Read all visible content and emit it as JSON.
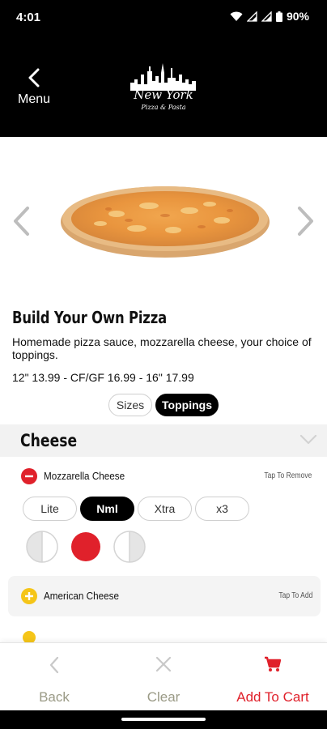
{
  "status_bar": {
    "time": "4:01",
    "battery": "90%"
  },
  "header": {
    "back_label": "Menu",
    "logo_title": "New York",
    "logo_subtitle": "Pizza & Pasta"
  },
  "product": {
    "title": "Build Your Own Pizza",
    "description": "Homemade pizza sauce, mozzarella cheese, your choice of toppings.",
    "price": "12\" 13.99 - CF/GF 16.99 - 16\" 17.99"
  },
  "tabs": [
    {
      "label": "Sizes",
      "active": false
    },
    {
      "label": "Toppings",
      "active": true
    }
  ],
  "section": {
    "title": "Cheese"
  },
  "toppings": [
    {
      "name": "Mozzarella Cheese",
      "action": "Tap To Remove",
      "selected": true
    },
    {
      "name": "American Cheese",
      "action": "Tap To Add",
      "selected": false
    }
  ],
  "amounts": [
    {
      "label": "Lite",
      "active": false
    },
    {
      "label": "Nml",
      "active": true
    },
    {
      "label": "Xtra",
      "active": false
    },
    {
      "label": "x3",
      "active": false
    }
  ],
  "portions": [
    {
      "icon": "left-half-icon",
      "active": false
    },
    {
      "icon": "whole-icon",
      "active": true
    },
    {
      "icon": "right-half-icon",
      "active": false
    }
  ],
  "bottom_bar": {
    "back_label": "Back",
    "clear_label": "Clear",
    "cart_label": "Add To Cart"
  },
  "colors": {
    "accent_red": "#e0212b",
    "add_yellow": "#f5c518",
    "muted_label": "#9a9a86"
  }
}
